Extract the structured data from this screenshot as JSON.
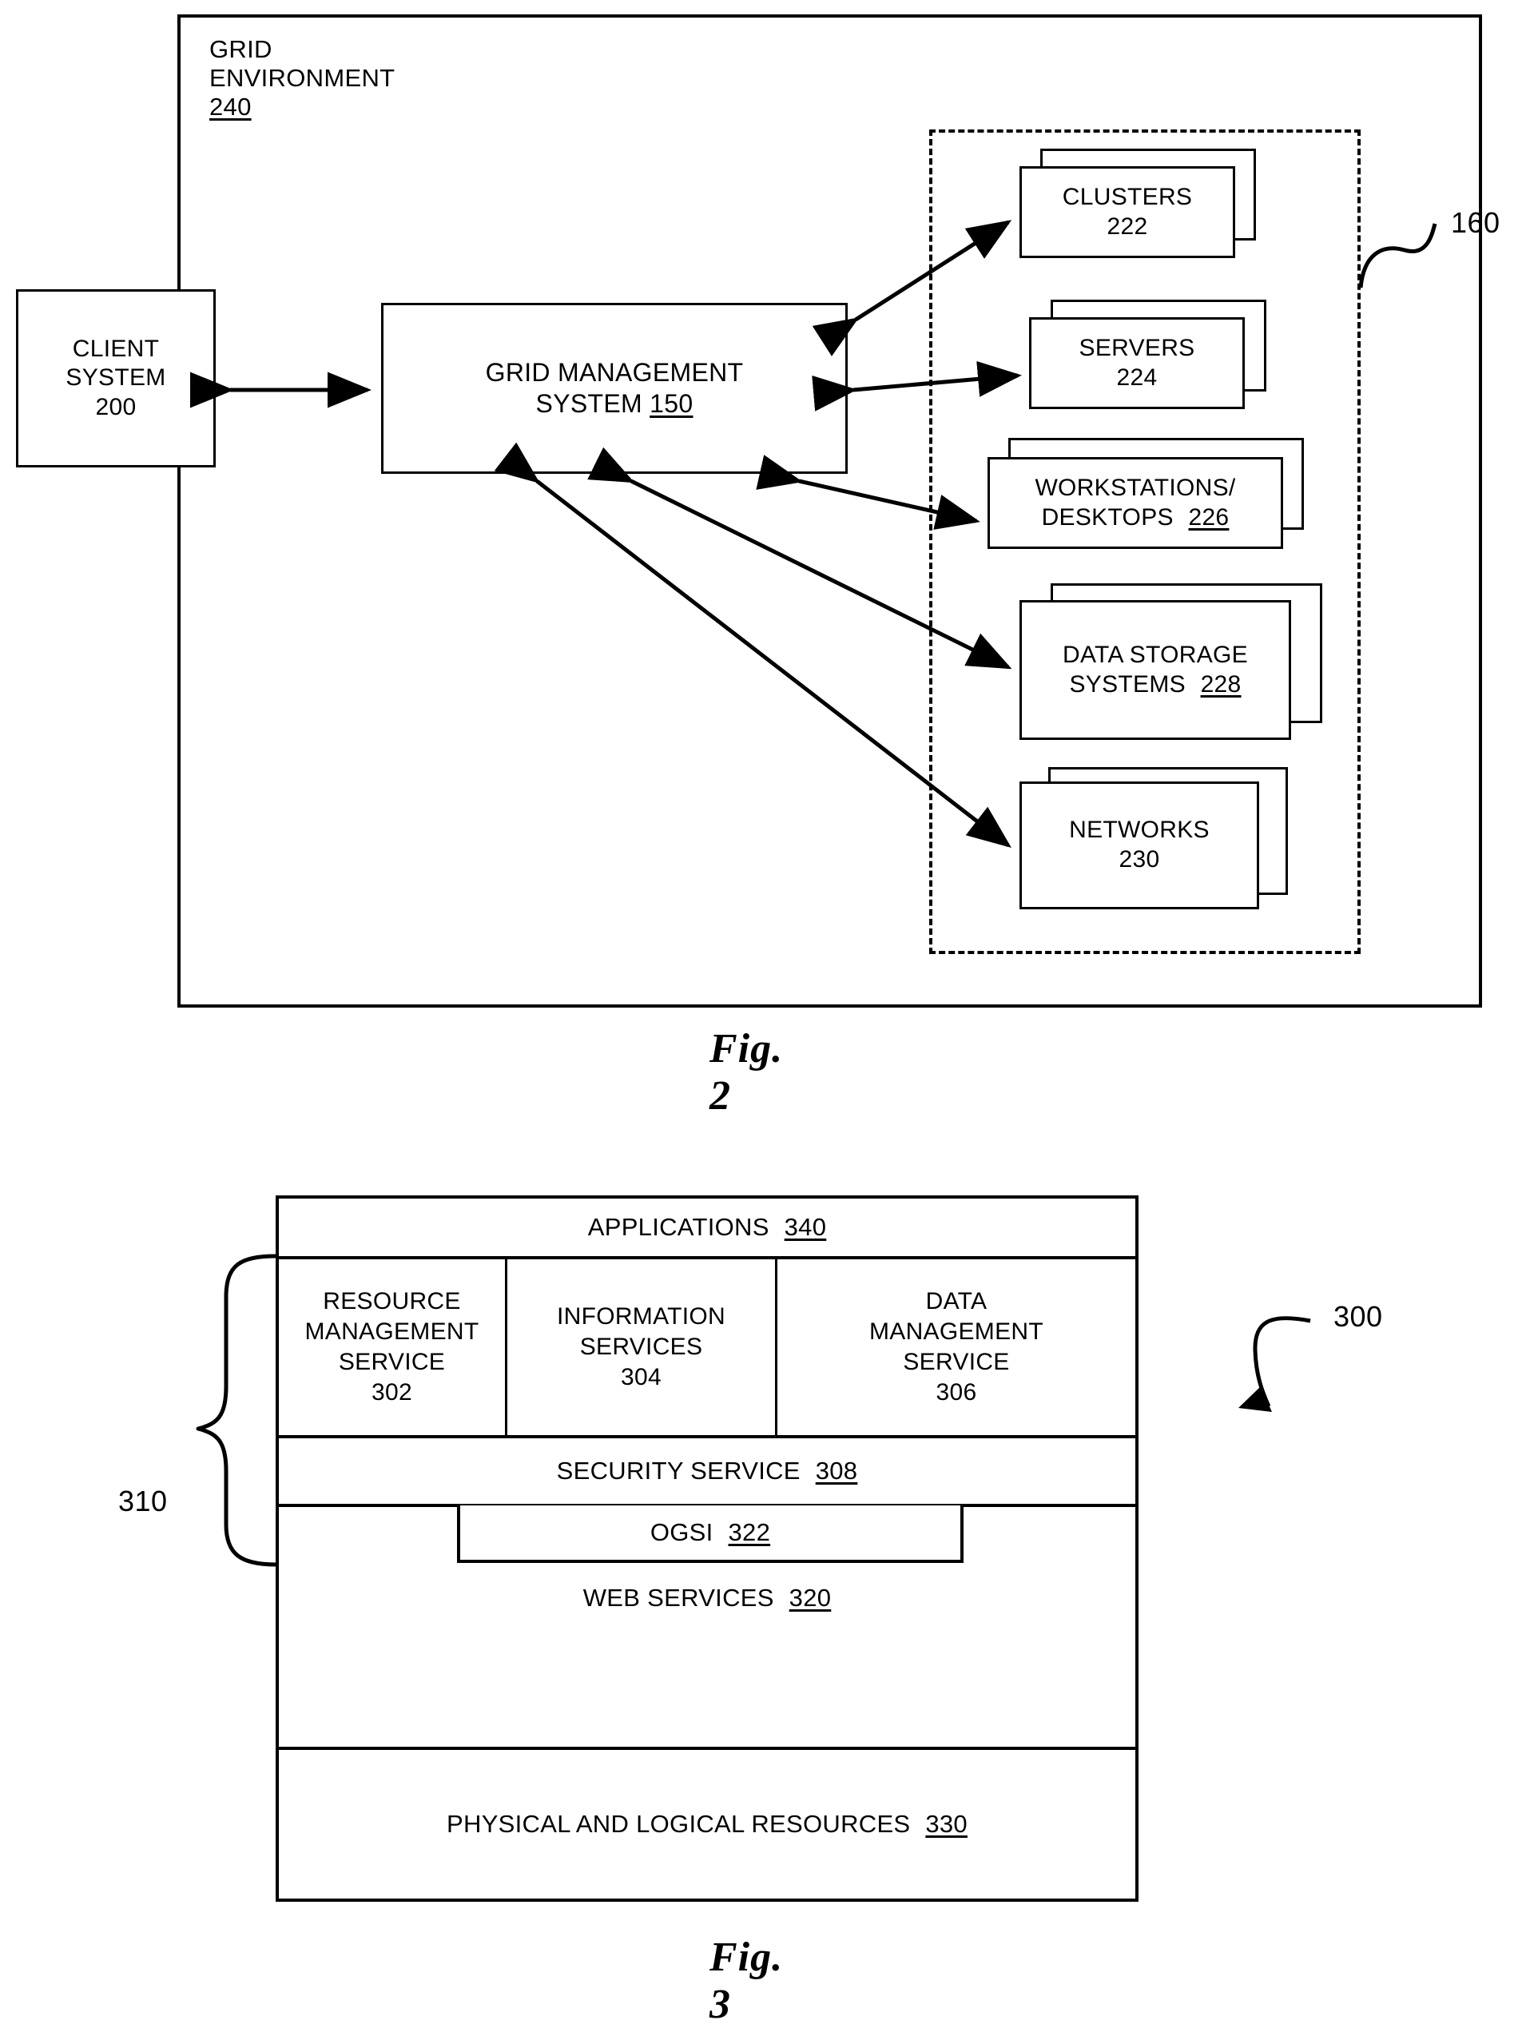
{
  "figure2": {
    "caption": "Fig. 2",
    "environment_label": "GRID ENVIRONMENT 240",
    "environment_label_text": "GRID ENVIRONMENT",
    "environment_label_ref": "240",
    "client": {
      "line1": "CLIENT",
      "line2": "SYSTEM",
      "ref": "200"
    },
    "grid_management": {
      "line1": "GRID MANAGEMENT",
      "line2": "SYSTEM",
      "ref": "150"
    },
    "resources_group_ref": "160",
    "resources": [
      {
        "name": "CLUSTERS",
        "ref": "222",
        "lines": 1
      },
      {
        "name": "SERVERS",
        "ref": "224",
        "lines": 1
      },
      {
        "name": "WORKSTATIONS/",
        "name2": "DESKTOPS",
        "ref": "226",
        "lines": 2
      },
      {
        "name": "DATA STORAGE",
        "name2": "SYSTEMS",
        "ref": "228",
        "lines": 2
      },
      {
        "name": "NETWORKS",
        "ref": "230",
        "lines": 1
      }
    ]
  },
  "figure3": {
    "caption": "Fig. 3",
    "stack_ref": "300",
    "brace_ref": "310",
    "applications": {
      "label": "APPLICATIONS",
      "ref": "340"
    },
    "services": [
      {
        "line1": "RESOURCE",
        "line2": "MANAGEMENT",
        "line3": "SERVICE",
        "ref": "302"
      },
      {
        "line1": "INFORMATION",
        "line2": "SERVICES",
        "line3": "",
        "ref": "304"
      },
      {
        "line1": "DATA",
        "line2": "MANAGEMENT",
        "line3": "SERVICE",
        "ref": "306"
      }
    ],
    "security": {
      "label": "SECURITY SERVICE",
      "ref": "308"
    },
    "ogsi": {
      "label": "OGSI",
      "ref": "322"
    },
    "web_services": {
      "label": "WEB SERVICES",
      "ref": "320"
    },
    "physical": {
      "label": "PHYSICAL AND LOGICAL RESOURCES",
      "ref": "330"
    }
  }
}
